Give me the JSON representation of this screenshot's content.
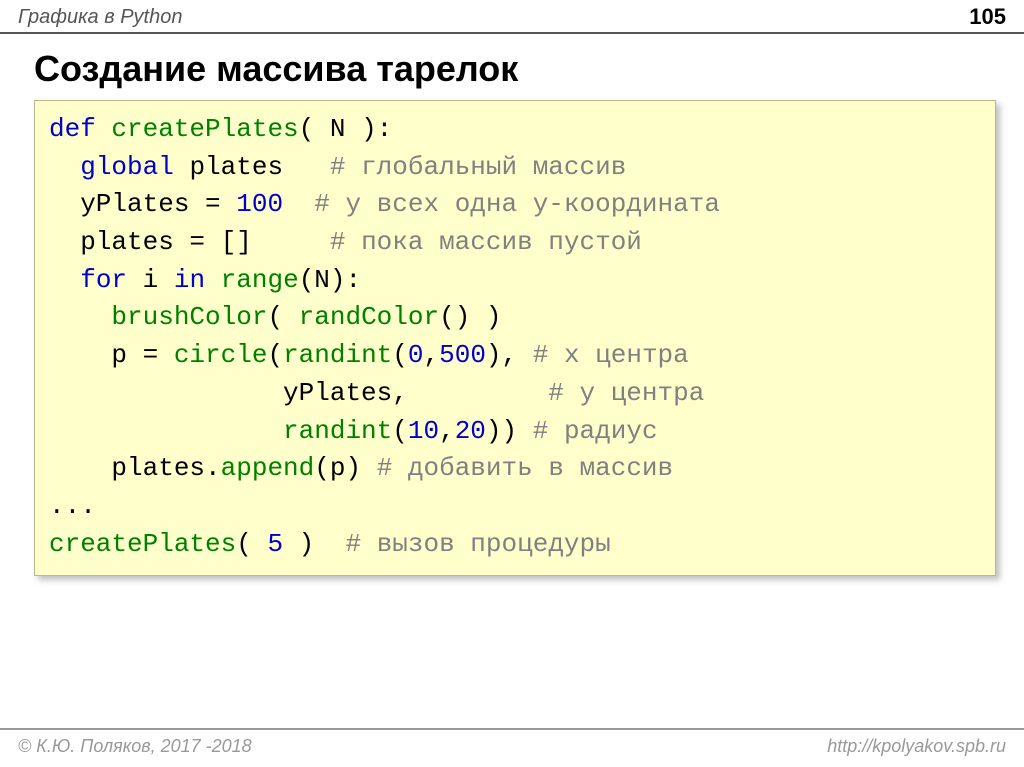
{
  "header": {
    "breadcrumb": "Графика в Python",
    "page_number": "105"
  },
  "title": "Создание массива тарелок",
  "code": {
    "l1_def": "def",
    "l1_fn": "createPlates",
    "l1_rest": "( N ):",
    "l2_kw": "global",
    "l2_var": " plates   ",
    "l2_cm": "# глобальный массив",
    "l3_a": "  yPlates = ",
    "l3_num": "100",
    "l3_pad": "  ",
    "l3_cm": "# у всех одна y-координата",
    "l4_a": "  plates = []     ",
    "l4_cm": "# пока массив пустой",
    "l5_for": "for",
    "l5_mid": " i ",
    "l5_in": "in",
    "l5_sp": " ",
    "l5_range": "range",
    "l5_rest": "(N):",
    "l6_pad": "    ",
    "l6_fn1": "brushColor",
    "l6_op": "( ",
    "l6_fn2": "randColor",
    "l6_rest": "() )",
    "l7_pad": "    p = ",
    "l7_fn": "circle",
    "l7_op": "(",
    "l7_fn2": "randint",
    "l7_op2": "(",
    "l7_n1": "0",
    "l7_c": ",",
    "l7_n2": "500",
    "l7_cl": "), ",
    "l7_cm": "# x центра",
    "l8_pad": "               yPlates,         ",
    "l8_cm": "# y центра",
    "l9_pad": "               ",
    "l9_fn": "randint",
    "l9_op": "(",
    "l9_n1": "10",
    "l9_c": ",",
    "l9_n2": "20",
    "l9_cl": ")) ",
    "l9_cm": "# радиус",
    "l10_pad": "    plates.",
    "l10_fn": "append",
    "l10_rest": "(p) ",
    "l10_cm": "# добавить в массив",
    "l11": "...",
    "l12_fn": "createPlates",
    "l12_op": "( ",
    "l12_n": "5",
    "l12_cl": " )  ",
    "l12_cm": "# вызов процедуры"
  },
  "footer": {
    "copyright": "© К.Ю. Поляков, 2017 -2018",
    "url": "http://kpolyakov.spb.ru"
  }
}
